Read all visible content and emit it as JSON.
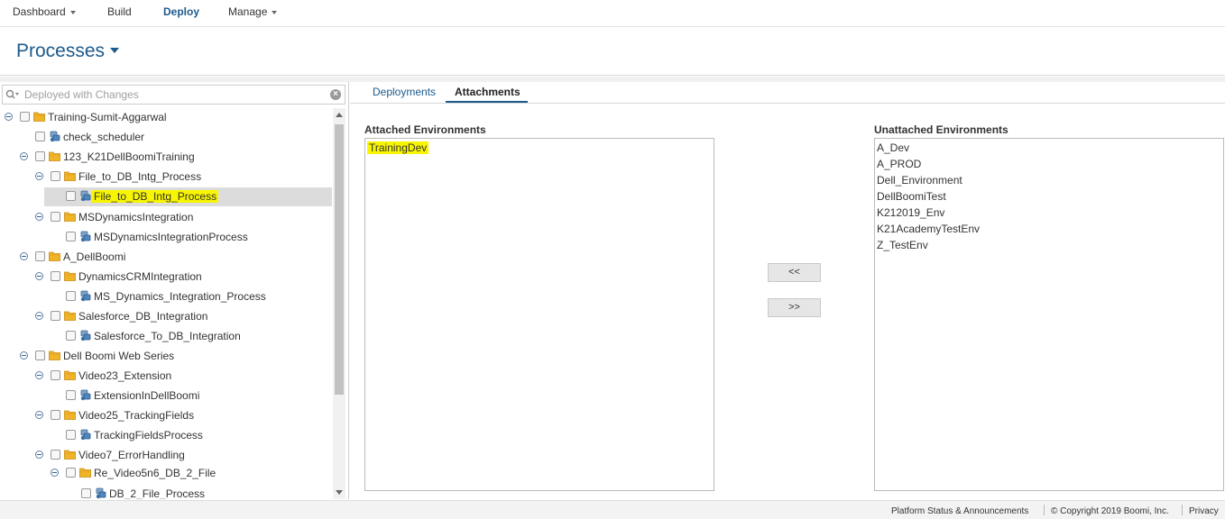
{
  "nav": {
    "items": [
      {
        "label": "Dashboard",
        "dropdown": true
      },
      {
        "label": "Build",
        "dropdown": false
      },
      {
        "label": "Deploy",
        "dropdown": false,
        "active": true
      },
      {
        "label": "Manage",
        "dropdown": true
      }
    ]
  },
  "page": {
    "title": "Processes"
  },
  "search": {
    "placeholder": "Deployed with Changes",
    "icon": "search-icon"
  },
  "tree": {
    "items": [
      {
        "level": 0,
        "toggle": true,
        "icon": "folder-icon",
        "label": "Training-Sumit-Aggarwal"
      },
      {
        "level": 1,
        "toggle": false,
        "icon": "process-icon",
        "label": "check_scheduler"
      },
      {
        "level": 1,
        "toggle": true,
        "icon": "folder-icon",
        "label": "123_K21DellBoomiTraining"
      },
      {
        "level": 2,
        "toggle": true,
        "icon": "folder-icon",
        "label": "File_to_DB_Intg_Process"
      },
      {
        "level": 3,
        "toggle": false,
        "icon": "process-icon",
        "label": "File_to_DB_Intg_Process",
        "selected": true,
        "highlight": true
      },
      {
        "level": 2,
        "toggle": true,
        "icon": "folder-icon",
        "label": "MSDynamicsIntegration"
      },
      {
        "level": 3,
        "toggle": false,
        "icon": "process-icon",
        "label": "MSDynamicsIntegrationProcess"
      },
      {
        "level": 1,
        "toggle": true,
        "icon": "folder-icon",
        "label": "A_DellBoomi"
      },
      {
        "level": 2,
        "toggle": true,
        "icon": "folder-icon",
        "label": "DynamicsCRMIntegration"
      },
      {
        "level": 3,
        "toggle": false,
        "icon": "process-icon",
        "label": "MS_Dynamics_Integration_Process"
      },
      {
        "level": 2,
        "toggle": true,
        "icon": "folder-icon",
        "label": "Salesforce_DB_Integration"
      },
      {
        "level": 3,
        "toggle": false,
        "icon": "process-icon",
        "label": "Salesforce_To_DB_Integration"
      },
      {
        "level": 1,
        "toggle": true,
        "icon": "folder-icon",
        "label": "Dell Boomi Web Series"
      },
      {
        "level": 2,
        "toggle": true,
        "icon": "folder-icon",
        "label": "Video23_Extension"
      },
      {
        "level": 3,
        "toggle": false,
        "icon": "process-icon",
        "label": "ExtensionInDellBoomi"
      },
      {
        "level": 2,
        "toggle": true,
        "icon": "folder-icon",
        "label": "Video25_TrackingFields"
      },
      {
        "level": 3,
        "toggle": false,
        "icon": "process-icon",
        "label": "TrackingFieldsProcess"
      },
      {
        "level": 2,
        "toggle": true,
        "icon": "folder-icon",
        "label": "Video7_ErrorHandling"
      },
      {
        "level": 3,
        "toggle": true,
        "icon": "folder-icon",
        "label": "Re_Video5n6_DB_2_File"
      },
      {
        "level": 4,
        "toggle": false,
        "icon": "process-icon",
        "label": "DB_2_File_Process"
      }
    ]
  },
  "tabs": [
    {
      "label": "Deployments",
      "active": false
    },
    {
      "label": "Attachments",
      "active": true
    }
  ],
  "attached": {
    "title": "Attached Environments",
    "items": [
      {
        "label": "TrainingDev",
        "highlight": true
      }
    ]
  },
  "unattached": {
    "title": "Unattached Environments",
    "items": [
      "A_Dev",
      "A_PROD",
      "Dell_Environment",
      "DellBoomiTest",
      "K212019_Env",
      "K21AcademyTestEnv",
      "Z_TestEnv"
    ]
  },
  "buttons": {
    "attach": "<<",
    "detach": ">>"
  },
  "footer": {
    "status": "Platform Status & Announcements",
    "copyright": "© Copyright 2019 Boomi, Inc.",
    "privacy": "Privacy"
  },
  "colors": {
    "accent": "#1c5a8c",
    "highlight": "#f8f500",
    "folder": "#f0b429"
  }
}
